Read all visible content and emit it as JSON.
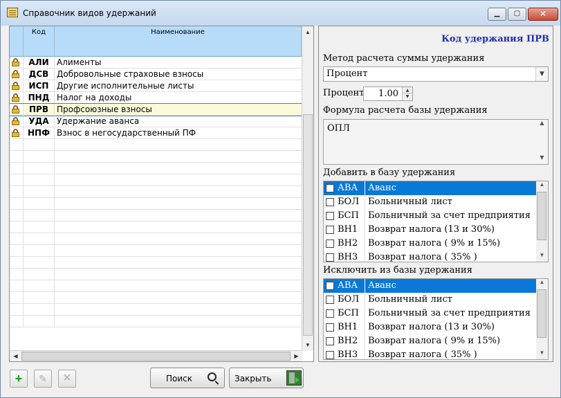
{
  "window": {
    "title": "Справочник видов удержаний",
    "controls": {
      "minimize": "▁",
      "maximize": "▢",
      "close": "✕"
    }
  },
  "grid": {
    "columns": {
      "code": "Код",
      "name": "Наименование"
    },
    "rows": [
      {
        "code": "АЛИ",
        "name": "Алименты",
        "locked": true
      },
      {
        "code": "ДСВ",
        "name": "Добровольные страховые взносы",
        "locked": true
      },
      {
        "code": "ИСП",
        "name": "Другие исполнительные листы",
        "locked": true
      },
      {
        "code": "ПНД",
        "name": "Налог на доходы",
        "locked": true
      },
      {
        "code": "ПРВ",
        "name": "Профсоюзные взносы",
        "locked": true,
        "selected": true
      },
      {
        "code": "УДА",
        "name": "Удержание аванса",
        "locked": true
      },
      {
        "code": "НПФ",
        "name": "Взнос в негосударственный ПФ",
        "locked": true
      }
    ]
  },
  "detail": {
    "title": "Код удержания ПРВ",
    "method_label": "Метод расчета суммы удержания",
    "method_value": "Процент",
    "percent_label": "Процент",
    "percent_value": "1.00",
    "formula_label": "Формула расчета базы удержания",
    "formula_value": "ОПЛ",
    "add_label": "Добавить в базу удержания",
    "exclude_label": "Исключить из базы удержания",
    "items": [
      {
        "code": "АВА",
        "name": "Аванс"
      },
      {
        "code": "БОЛ",
        "name": "Больничный лист"
      },
      {
        "code": "БСП",
        "name": "Больничный за счет предприятия"
      },
      {
        "code": "ВН1",
        "name": "Возврат налога (13 и 30%)"
      },
      {
        "code": "ВН2",
        "name": "Возврат налога ( 9% и 15%)"
      },
      {
        "code": "ВН3",
        "name": "Возврат налога ( 35% )"
      }
    ]
  },
  "buttons": {
    "add": "+",
    "edit": "✎",
    "delete": "✕",
    "search": "Поиск",
    "close": "Закрыть"
  },
  "colors": {
    "accent": "#0a78d6",
    "title": "#1f2db5",
    "header": "#b7dcfa"
  }
}
